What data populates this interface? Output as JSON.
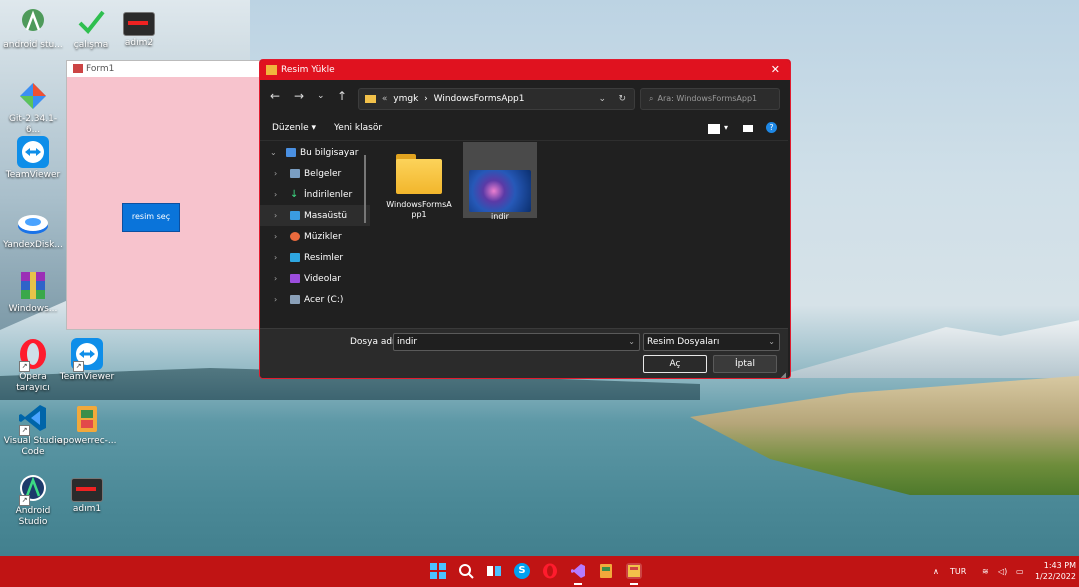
{
  "desktop_icons": [
    {
      "label": "android stu...",
      "color": "#3ddc84"
    },
    {
      "label": "çalışma",
      "color": "#2fbf4f"
    },
    {
      "label": "adım2",
      "color": "#444444"
    },
    {
      "label": "Git-2.34.1-6...",
      "color": "#f05032"
    },
    {
      "label": "TeamViewer",
      "color": "#0e8ee9"
    },
    {
      "label": "YandexDisk...",
      "color": "#1a73e8"
    },
    {
      "label": "Windows...",
      "color": "#8b2fb6"
    },
    {
      "label": "Opera tarayıcı",
      "color": "#ff1b2d"
    },
    {
      "label": "TeamViewer",
      "color": "#0e8ee9"
    },
    {
      "label": "Visual Studio Code",
      "color": "#0065a9"
    },
    {
      "label": "apowerrec-...",
      "color": "#f2a93b"
    },
    {
      "label": "Android Studio",
      "color": "#3ddc84"
    },
    {
      "label": "adım1",
      "color": "#444444"
    }
  ],
  "form1": {
    "title": "Form1",
    "button_label": "resim seç"
  },
  "dialog": {
    "title": "Resim Yükle",
    "address": {
      "prefix": "«",
      "part1": "ymgk",
      "sep": "›",
      "part2": "WindowsFormsApp1"
    },
    "search_placeholder": "Ara: WindowsFormsApp1",
    "toolbar": {
      "organize": "Düzenle",
      "new_folder": "Yeni klasör"
    },
    "tree": [
      {
        "label": "Bu bilgisayar",
        "color": "#4a90e2",
        "expanded": true
      },
      {
        "label": "Belgeler",
        "color": "#7a9ec2"
      },
      {
        "label": "İndirilenler",
        "color": "#3ddc84"
      },
      {
        "label": "Masaüstü",
        "color": "#3a9be0",
        "selected": true
      },
      {
        "label": "Müzikler",
        "color": "#ea6a3d"
      },
      {
        "label": "Resimler",
        "color": "#2ea6e0"
      },
      {
        "label": "Videolar",
        "color": "#9b4ddd"
      },
      {
        "label": "Acer (C:)",
        "color": "#8aa0b8"
      }
    ],
    "files": [
      {
        "name": "WindowsFormsApp1",
        "line1": "WindowsFormsA",
        "line2": "pp1",
        "type": "folder"
      },
      {
        "name": "indir",
        "type": "image",
        "selected": true
      }
    ],
    "filename_label": "Dosya adı:",
    "filename_value": "indir",
    "filter_value": "Resim Dosyaları",
    "open_label": "Aç",
    "cancel_label": "İptal"
  },
  "taskbar": {
    "language": "TUR",
    "time": "1:43 PM",
    "date": "1/22/2022"
  }
}
